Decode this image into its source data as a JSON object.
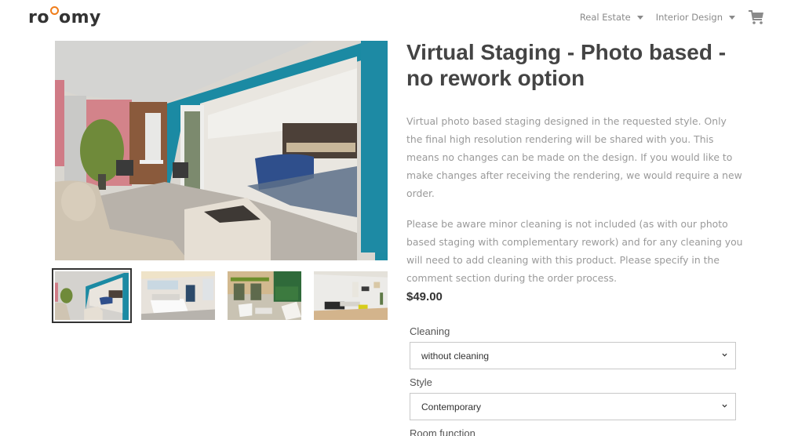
{
  "header": {
    "logo": {
      "part1": "ro",
      "part2": "omy",
      "accent_color": "#f07d1a"
    },
    "nav": [
      {
        "label": "Real Estate",
        "icon": "caret-down-icon"
      },
      {
        "label": "Interior Design",
        "icon": "caret-down-icon"
      }
    ],
    "cart_icon": "shopping-cart-icon"
  },
  "gallery": {
    "main_image": "Staged patio opening into living room with blue sofa and fire table",
    "thumbnails": [
      {
        "label": "Patio and living room staging",
        "active": true
      },
      {
        "label": "Bedroom staging",
        "active": false
      },
      {
        "label": "Terrace with outdoor seating",
        "active": false
      },
      {
        "label": "Living room with yellow ottoman",
        "active": false
      }
    ]
  },
  "product": {
    "title": "Virtual Staging - Photo based - no rework option",
    "description": [
      "Virtual photo based staging designed in the requested style. Only the final high resolution rendering will be shared with you. This means no changes can be made on the design. If you would like to make changes after receiving the rendering, we would require a new order.",
      "Please be aware minor cleaning is not included (as with our photo based staging with complementary rework) and for any cleaning you will need to add cleaning with this product. Please specify in the comment section during the order process."
    ],
    "price": "$49.00",
    "options": [
      {
        "label": "Cleaning",
        "value": "without cleaning"
      },
      {
        "label": "Style",
        "value": "Contemporary"
      },
      {
        "label": "Room function",
        "value": ""
      }
    ]
  }
}
